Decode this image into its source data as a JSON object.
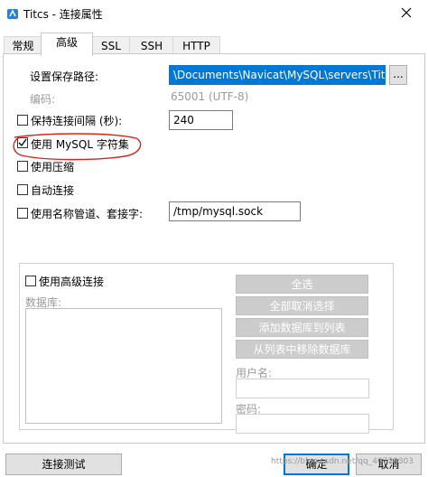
{
  "window": {
    "title": "Titcs - 连接属性"
  },
  "tabs": [
    {
      "label": "常规"
    },
    {
      "label": "高级"
    },
    {
      "label": "SSL"
    },
    {
      "label": "SSH"
    },
    {
      "label": "HTTP"
    }
  ],
  "advanced": {
    "save_path_label": "设置保存路径:",
    "save_path_value": "\\Documents\\Navicat\\MySQL\\servers\\Titcs",
    "browse_label": "...",
    "encoding_label": "编码:",
    "encoding_value": "65001 (UTF-8)",
    "keepalive_label": "保持连接间隔 (秒):",
    "keepalive_checked": false,
    "keepalive_value": "240",
    "mysql_charset_label": "使用 MySQL 字符集",
    "mysql_charset_checked": true,
    "compression_label": "使用压缩",
    "compression_checked": false,
    "auto_connect_label": "自动连接",
    "auto_connect_checked": false,
    "named_pipe_label": "使用名称管道、套接字:",
    "named_pipe_checked": false,
    "named_pipe_value": "/tmp/mysql.sock"
  },
  "advanced_connection": {
    "label": "使用高级连接",
    "checked": false,
    "databases_label": "数据库:",
    "select_all": "全选",
    "deselect_all": "全部取消选择",
    "add_to_list": "添加数据库到列表",
    "remove_from_list": "从列表中移除数据库",
    "username_label": "用户名:",
    "password_label": "密码:"
  },
  "footer": {
    "test_connection": "连接测试",
    "ok": "确定",
    "cancel": "取消",
    "watermark": "https://blog.csdn.net/qq_40739303"
  },
  "colors": {
    "selection": "#0078d7",
    "annotation": "#e0201a"
  }
}
